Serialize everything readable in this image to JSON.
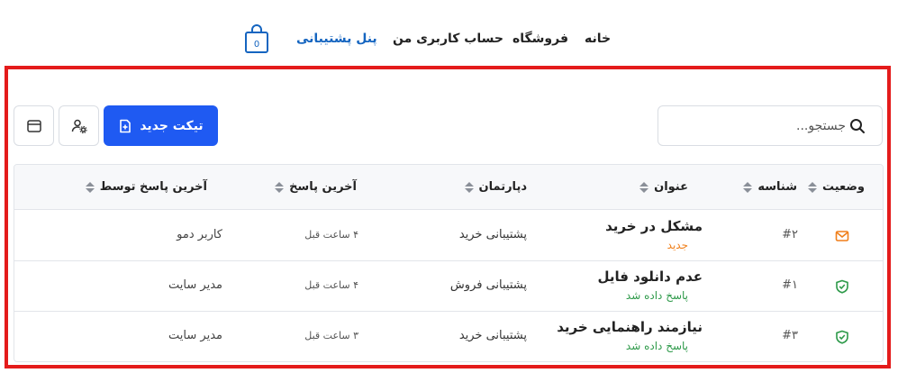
{
  "nav": {
    "home": "خانه",
    "shop": "فروشگاه",
    "account": "حساب کاربری من",
    "support": "پنل پشتیبانی"
  },
  "toolbar": {
    "search_placeholder": "جستجو...",
    "new_ticket_label": "تیکت جدید"
  },
  "table": {
    "headers": {
      "status": "وضعیت",
      "id": "شناسه",
      "title": "عنوان",
      "department": "دپارتمان",
      "last_reply": "آخرین پاسخ",
      "last_reply_by": "آخرین پاسخ توسط"
    },
    "rows": [
      {
        "status_icon": "envelope-icon",
        "id": "#۲",
        "title": "مشکل در خرید",
        "status_text": "جدید",
        "department": "پشتیبانی خرید",
        "last_reply": "۴ ساعت قبل",
        "last_reply_by": "کاربر دمو"
      },
      {
        "status_icon": "shield-check-icon",
        "id": "#۱",
        "title": "عدم دانلود فایل",
        "status_text": "پاسخ داده شد",
        "department": "پشتیبانی فروش",
        "last_reply": "۴ ساعت قبل",
        "last_reply_by": "مدیر سایت"
      },
      {
        "status_icon": "shield-check-icon",
        "id": "#۳",
        "title": "نیازمند راهنمایی خرید",
        "status_text": "پاسخ داده شد",
        "department": "پشتیبانی خرید",
        "last_reply": "۳ ساعت قبل",
        "last_reply_by": "مدیر سایت"
      }
    ]
  },
  "colors": {
    "accent": "#1f5af2",
    "nav_active": "#1565c0",
    "status_new": "#f07f1a",
    "status_answered": "#2e9a4a",
    "highlight_frame": "#e41b1b"
  }
}
